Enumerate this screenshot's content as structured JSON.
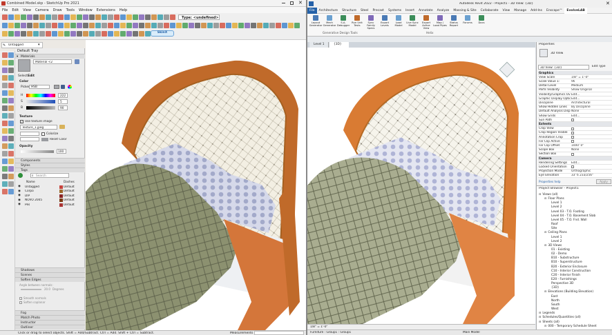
{
  "sketchup": {
    "window_title": "Combined Model.skp - SketchUp Pro 2021",
    "menu": [
      "File",
      "Edit",
      "View",
      "Camera",
      "Draw",
      "Tools",
      "Window",
      "Extensions",
      "Help"
    ],
    "tag_dropdown": "Untagged",
    "type_box": "Type: <undefined>",
    "tray": {
      "title": "Default Tray",
      "materials_header": "Materials",
      "material_name": "Material <2",
      "tabs": [
        "Select",
        "Edit"
      ],
      "color_label": "Color",
      "picker_label": "Picker:",
      "picker_value": "HSB",
      "channels": [
        {
          "label": "H",
          "value": "222"
        },
        {
          "label": "S",
          "value": "5"
        },
        {
          "label": "B",
          "value": "90"
        }
      ],
      "texture_label": "Texture",
      "use_texture": "Use texture image",
      "texture_file": "Texture_1.jpeg",
      "colorize": "Colorize",
      "reset_color": "Reset Color",
      "opacity_label": "Opacity",
      "opacity_value": "100",
      "collapsed": [
        "Components",
        "Styles"
      ],
      "tags_header": "Tags",
      "search_placeholder": "Search",
      "tags_columns": [
        "Name",
        "Dashes"
      ],
      "tags": [
        {
          "name": "Untagged",
          "dash": "Default",
          "color": "#c7423c"
        },
        {
          "name": "Corpo",
          "dash": "Default",
          "color": "#9c6a2c"
        },
        {
          "name": "DIP",
          "dash": "Default",
          "color": "#8a2222"
        },
        {
          "name": "NOVO 2005",
          "dash": "Default",
          "color": "#7a3b12"
        },
        {
          "name": "Pés",
          "dash": "Default",
          "color": "#aa3333"
        }
      ],
      "bottom_sections": [
        "Shadows",
        "Scenes",
        "Soften Edges"
      ],
      "soften": {
        "angle_label": "Angle between normals:",
        "angle_value": "20.0",
        "angle_unit": "Degrees",
        "smooth": "Smooth normals",
        "soften_coplanar": "Soften coplanar"
      },
      "bottom_sections2": [
        "Fog",
        "Match Photo",
        "Instructor",
        "Outliner"
      ]
    },
    "status_text": "Click or drag to select objects. Shift = Add/Subtract. Ctrl = Add. Shift + Ctrl = Subtract.",
    "measurements_label": "Measurements"
  },
  "revit": {
    "window_title": "Autodesk Revit 2022 - Project1 - 3D View: {3D}",
    "tabs": [
      "File",
      "Architecture",
      "Structure",
      "Steel",
      "Precast",
      "Systems",
      "Insert",
      "Annotate",
      "Analyze",
      "Massing & Site",
      "Collaborate",
      "View",
      "Manage",
      "Add-Ins",
      "Enscape™",
      "EvolveLAB",
      "Henderson Engineers"
    ],
    "active_tab": "EvolveLAB",
    "ribbon": [
      {
        "label": "Layout Generator"
      },
      {
        "label": "Mech Generator"
      },
      {
        "label": "S.A. Debugger"
      },
      {
        "label": "Run Unit Tests"
      },
      {
        "label": "Sync Family Specs"
      },
      {
        "label": "Export Levels"
      },
      {
        "label": "Load Model"
      },
      {
        "label": "Live Sync Model"
      },
      {
        "label": "Export Active View"
      },
      {
        "label": "Map / Load Pipes"
      },
      {
        "label": "Status Report"
      },
      {
        "label": "Forums"
      },
      {
        "label": "Docs"
      }
    ],
    "ribbon_groups": [
      "Generative Design Tools",
      "Helix"
    ],
    "view_tabs": [
      "Level 1",
      "{3D}"
    ],
    "scale_text": "1/8\" = 1'-0\"",
    "status_text": "Furniture : Group1 : Group1",
    "main_model": "Main Model",
    "properties": {
      "header": "Properties",
      "type": "3D View",
      "selector": "3D View: {3D}",
      "edit_type": "Edit Type",
      "groups": [
        {
          "name": "Graphics",
          "rows": [
            [
              "View Scale",
              "1/8\" = 1'-0\""
            ],
            [
              "Scale Value 1:",
              "96"
            ],
            [
              "Detail Level",
              "Medium"
            ],
            [
              "Parts Visibility",
              "Show Original"
            ],
            [
              "Visibility/Graphics Overr...",
              "Edit..."
            ],
            [
              "Graphic Display Options",
              "Edit..."
            ],
            [
              "Discipline",
              "Architectural"
            ],
            [
              "Show Hidden Lines",
              "By Discipline"
            ],
            [
              "Default Analysis Display ...",
              "None"
            ],
            [
              "Show Grids",
              "Edit..."
            ],
            [
              "Sun Path",
              ""
            ]
          ]
        },
        {
          "name": "Extents",
          "rows": [
            [
              "Crop View",
              ""
            ],
            [
              "Crop Region Visible",
              ""
            ],
            [
              "Annotation Crop",
              ""
            ],
            [
              "Far Clip Active",
              ""
            ],
            [
              "Far Clip Offset",
              "1000' 0\""
            ],
            [
              "Scope Box",
              "None"
            ],
            [
              "Section Box",
              ""
            ]
          ]
        },
        {
          "name": "Camera",
          "rows": [
            [
              "Rendering Settings",
              "Edit..."
            ],
            [
              "Locked Orientation",
              ""
            ],
            [
              "Projection Mode",
              "Orthographic"
            ],
            [
              "Eye Elevation",
              "33' 6 233/256\""
            ]
          ]
        }
      ],
      "help": "Properties help",
      "apply": "Apply"
    },
    "browser": {
      "header": "Project Browser - Project1",
      "items": [
        {
          "t": "Views (all)",
          "d": 0
        },
        {
          "t": "Floor Plans",
          "d": 1
        },
        {
          "t": "Level 1",
          "d": 2
        },
        {
          "t": "Level 2",
          "d": 2
        },
        {
          "t": "Level 03 - T.O. Footing",
          "d": 2
        },
        {
          "t": "Level 04 - T.O. Basement Slab",
          "d": 2
        },
        {
          "t": "Level 05 - T.O. Fnd. Wall",
          "d": 2
        },
        {
          "t": "Roof",
          "d": 2
        },
        {
          "t": "Site",
          "d": 2
        },
        {
          "t": "Ceiling Plans",
          "d": 1
        },
        {
          "t": "Level 1",
          "d": 2
        },
        {
          "t": "Level 2",
          "d": 2
        },
        {
          "t": "3D Views",
          "d": 1
        },
        {
          "t": "01 - Existing",
          "d": 2
        },
        {
          "t": "02 - Demo",
          "d": 2
        },
        {
          "t": "B10 - Substructure",
          "d": 2
        },
        {
          "t": "B10 - Superstructure",
          "d": 2
        },
        {
          "t": "B20 - Exterior Enclosure",
          "d": 2
        },
        {
          "t": "C10 - Interior Construction",
          "d": 2
        },
        {
          "t": "C20 - Interior Finish",
          "d": 2
        },
        {
          "t": "E20 - Furnishings",
          "d": 2
        },
        {
          "t": "Perspective 3D",
          "d": 2
        },
        {
          "t": "{3D}",
          "d": 2
        },
        {
          "t": "Elevations (Building Elevation)",
          "d": 1
        },
        {
          "t": "East",
          "d": 2
        },
        {
          "t": "North",
          "d": 2
        },
        {
          "t": "South",
          "d": 2
        },
        {
          "t": "West",
          "d": 2
        },
        {
          "t": "Legends",
          "d": 0
        },
        {
          "t": "Schedules/Quantities (all)",
          "d": 0
        },
        {
          "t": "Sheets (all)",
          "d": 0
        },
        {
          "t": "000 - Temporary Schedule Sheet",
          "d": 1
        }
      ]
    }
  }
}
